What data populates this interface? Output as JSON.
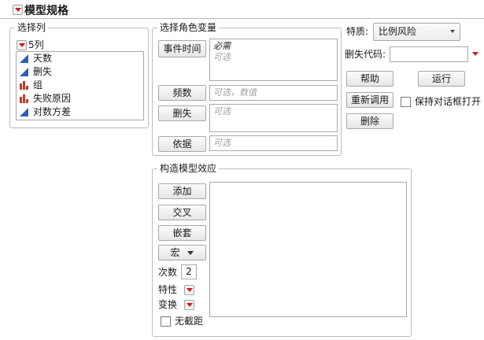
{
  "window": {
    "title": "模型规格"
  },
  "select_columns": {
    "legend": "选择列",
    "count_label": "5列",
    "columns": [
      {
        "name": "天数",
        "type": "continuous"
      },
      {
        "name": "删失",
        "type": "continuous"
      },
      {
        "name": "组",
        "type": "nominal"
      },
      {
        "name": "失败原因",
        "type": "nominal"
      },
      {
        "name": "对数方差",
        "type": "continuous"
      }
    ]
  },
  "roles": {
    "legend": "选择角色变量",
    "event_time": {
      "button": "事件时间",
      "required": "必需",
      "optional": "可选"
    },
    "freq": {
      "button": "频数",
      "placeholder": "可选，数值"
    },
    "censor": {
      "button": "删失",
      "placeholder": "可选"
    },
    "by": {
      "button": "依据",
      "placeholder": "可选"
    }
  },
  "personality": {
    "label": "特质:",
    "value": "比例风险"
  },
  "censor_code": {
    "label": "删失代码:",
    "value": ""
  },
  "actions": {
    "help": "帮助",
    "run": "运行",
    "recall": "重新调用",
    "keep_open": "保持对话框打开",
    "remove": "删除"
  },
  "effects": {
    "legend": "构造模型效应",
    "add": "添加",
    "cross": "交叉",
    "nest": "嵌套",
    "macros": "宏",
    "degree_label": "次数",
    "degree_value": "2",
    "attributes_label": "特性",
    "transform_label": "变换",
    "no_intercept": "无截距"
  },
  "colors": {
    "red_triangle": "#d21a1a",
    "continuous_icon": "#2f5fb4",
    "nominal_icon": "#c0392b"
  }
}
